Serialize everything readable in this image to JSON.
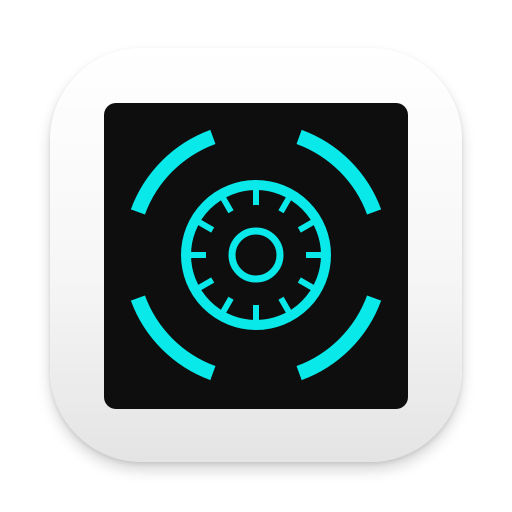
{
  "app_icon": {
    "name": "dial-vault-icon",
    "colors": {
      "tile": "#f4f4f4",
      "background": "#0e0e0e",
      "accent": "#0ae9ea"
    }
  }
}
